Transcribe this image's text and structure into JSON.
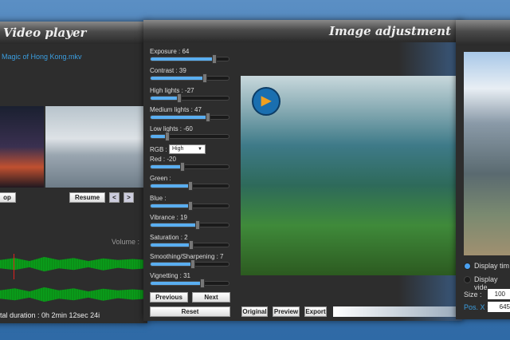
{
  "video_player": {
    "title": "Video player",
    "filename": "Magic of Hong Kong.mkv",
    "stop_label": "op",
    "resume_label": "Resume",
    "prev_label": "<",
    "next_label": ">",
    "volume_label": "Volume :",
    "duration": "tal duration : 0h 2min 12sec 24i"
  },
  "image_adjustment": {
    "title": "Image adjustment",
    "sliders": [
      {
        "label": "Exposure : 64",
        "fraction": 0.82
      },
      {
        "label": "Contrast : 39",
        "fraction": 0.69
      },
      {
        "label": "High lights : -27",
        "fraction": 0.37
      },
      {
        "label": "Medium lights : 47",
        "fraction": 0.73
      },
      {
        "label": "Low lights : -60",
        "fraction": 0.21
      }
    ],
    "rgb_label": "RGB :",
    "rgb_value": "High",
    "sliders2": [
      {
        "label": "Red : -20",
        "fraction": 0.41
      },
      {
        "label": "Green :",
        "fraction": 0.51
      },
      {
        "label": "Blue :",
        "fraction": 0.51
      },
      {
        "label": "Vibrance : 19",
        "fraction": 0.6
      },
      {
        "label": "Saturation : 2",
        "fraction": 0.52
      },
      {
        "label": "Smoothing/Sharpening : 7",
        "fraction": 0.54
      },
      {
        "label": "Vignetting : 31",
        "fraction": 0.66
      }
    ],
    "previous_label": "Previous",
    "next_label": "Next",
    "reset_label": "Reset",
    "original_label": "Original",
    "preview_label": "Preview",
    "export_label": "Export"
  },
  "overlay": {
    "display_time_label": "Display tim",
    "display_video_label": "Display vide",
    "size_label": "Size :",
    "size_value": "100",
    "posx_label": "Pos. X :",
    "posx_value": "645"
  }
}
